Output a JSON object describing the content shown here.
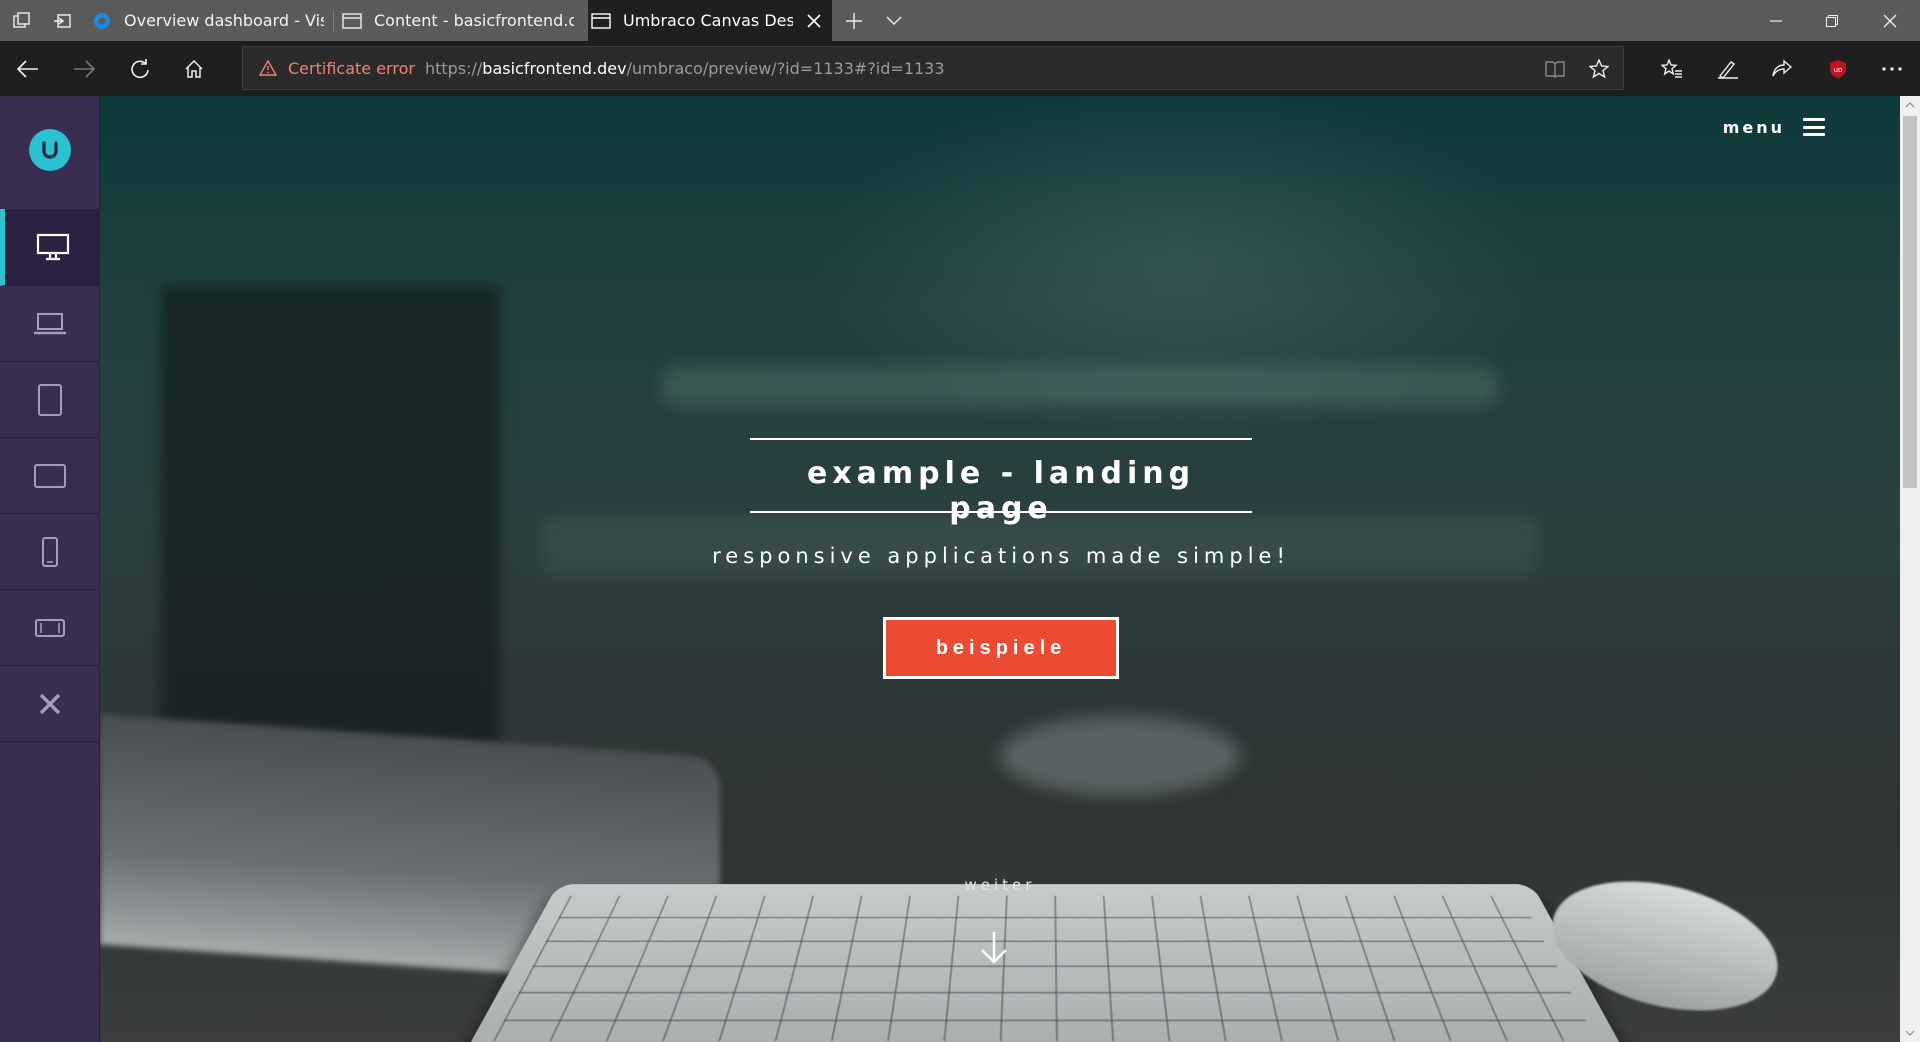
{
  "browser": {
    "tabs": [
      {
        "title": "Overview dashboard - Visua",
        "icon": "visual-studio-icon",
        "active": false
      },
      {
        "title": "Content - basicfrontend.dev",
        "icon": "page-icon",
        "active": false
      },
      {
        "title": "Umbraco Canvas Designer",
        "icon": "page-icon",
        "active": true
      }
    ],
    "address": {
      "cert_error": "Certificate error",
      "url_scheme": "https://",
      "url_host": "basicfrontend.dev",
      "url_path": "/umbraco/preview/?id=1133#?id=1133"
    },
    "colors": {
      "tabbar": "#5b5b5b",
      "chrome": "#1f1f1f",
      "cert_error": "#f0807a"
    }
  },
  "canvas_designer": {
    "rail_items": [
      {
        "name": "desktop-icon",
        "active": true
      },
      {
        "name": "laptop-icon",
        "active": false
      },
      {
        "name": "tablet-portrait-icon",
        "active": false
      },
      {
        "name": "tablet-landscape-icon",
        "active": false
      },
      {
        "name": "phone-portrait-icon",
        "active": false
      },
      {
        "name": "phone-landscape-icon",
        "active": false
      },
      {
        "name": "close-icon",
        "active": false
      }
    ],
    "colors": {
      "rail": "#3a2d52",
      "accent": "#2bc4cf"
    }
  },
  "page": {
    "menu_label": "menu",
    "title": "example - landing page",
    "subtitle": "responsive applications made simple!",
    "cta_label": "beispiele",
    "scroll_label": "weiter",
    "colors": {
      "cta": "#ec4b33",
      "text": "#ffffff"
    }
  }
}
